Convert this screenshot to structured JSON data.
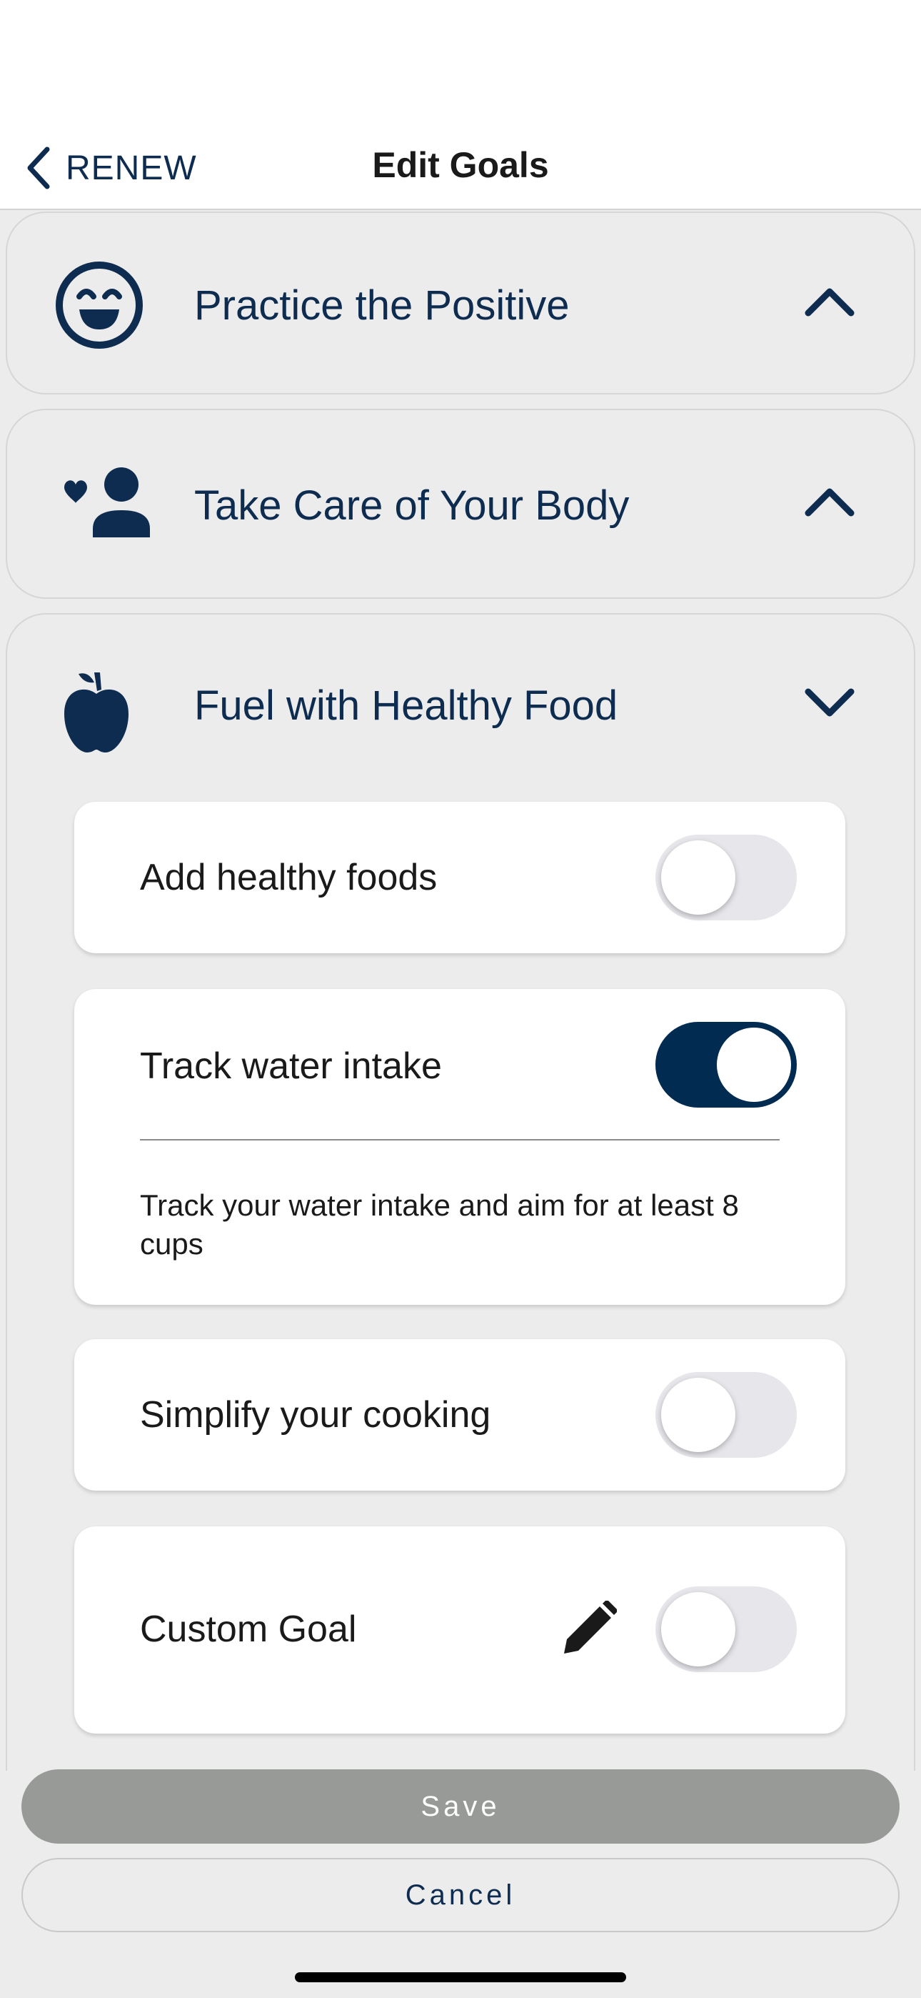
{
  "nav": {
    "back_label": "RENEW",
    "title": "Edit Goals"
  },
  "sections": [
    {
      "title": "Practice the Positive",
      "icon": "smiley-face-icon",
      "expanded": false
    },
    {
      "title": "Take Care of Your Body",
      "icon": "person-heart-icon",
      "expanded": false
    },
    {
      "title": "Fuel with Healthy Food",
      "icon": "apple-icon",
      "expanded": true
    }
  ],
  "goals": [
    {
      "label": "Add healthy foods",
      "enabled": false
    },
    {
      "label": "Track water intake",
      "enabled": true,
      "description": "Track your water intake and aim for at least 8 cups"
    },
    {
      "label": "Simplify your cooking",
      "enabled": false
    },
    {
      "label": "Custom Goal",
      "enabled": false,
      "editable": true
    }
  ],
  "actions": {
    "save_label": "Save",
    "cancel_label": "Cancel"
  },
  "colors": {
    "primary": "#022b52",
    "background": "#ececec",
    "save_disabled": "#979a97"
  }
}
